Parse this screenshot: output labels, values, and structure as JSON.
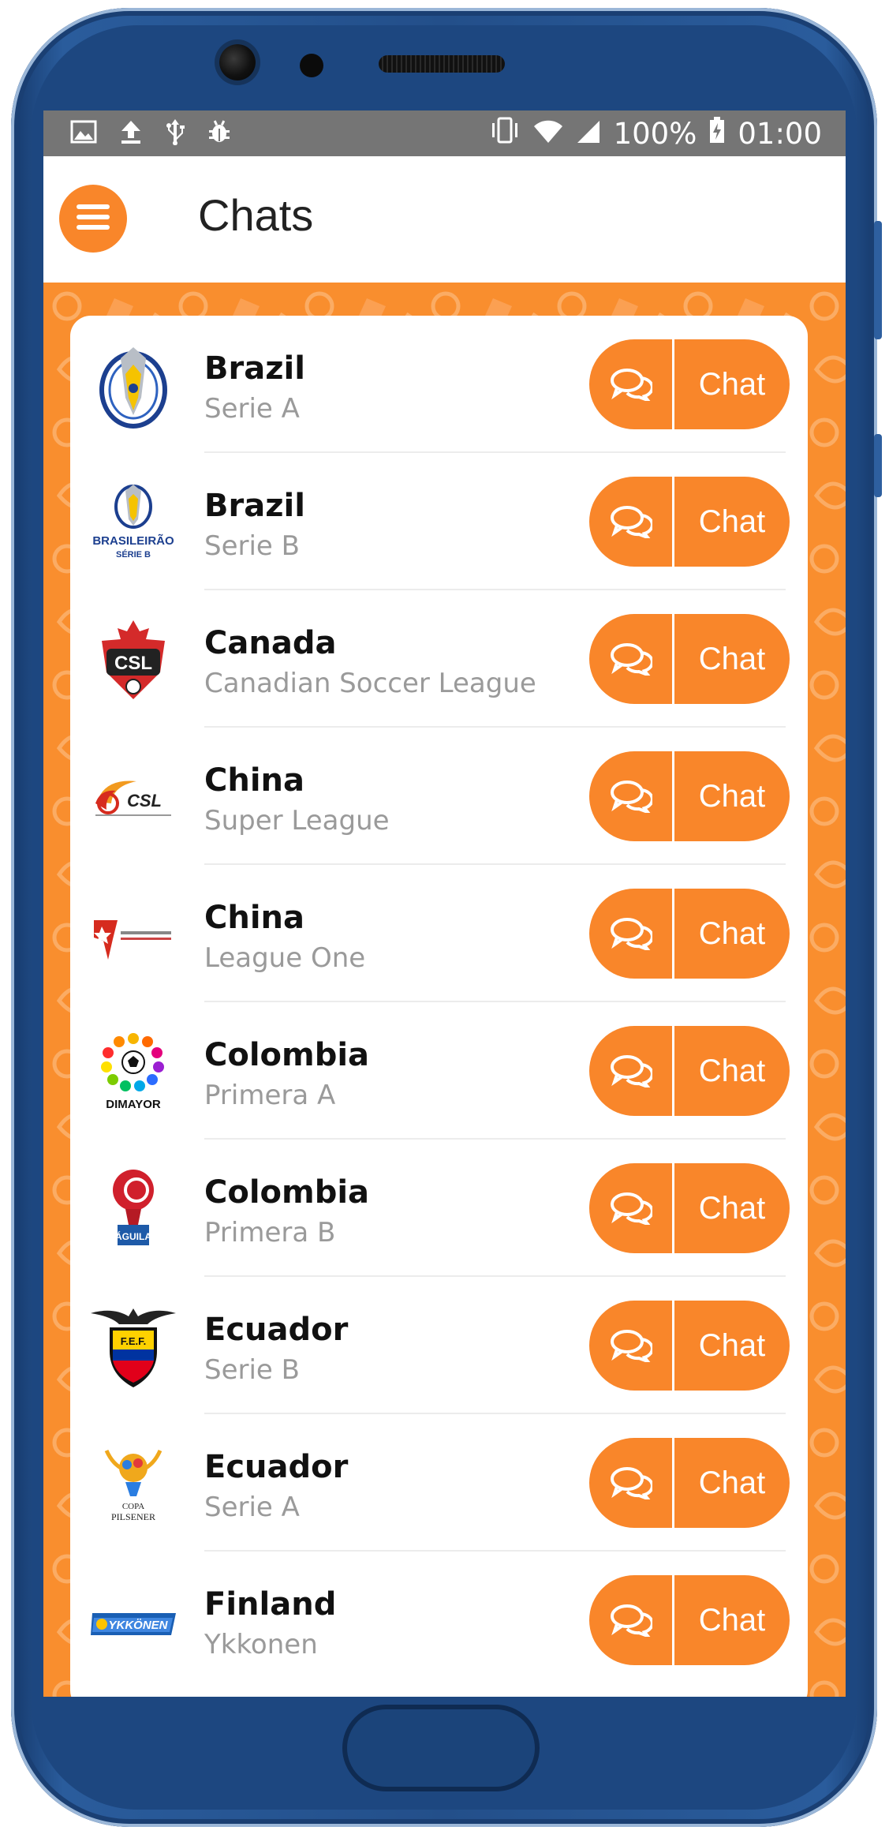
{
  "status_bar": {
    "battery": "100%",
    "time": "01:00",
    "icons": [
      "image-icon",
      "upload-icon",
      "usb-icon",
      "android-debug-icon",
      "vibrate-icon",
      "wifi-icon",
      "signal-icon",
      "battery-icon"
    ]
  },
  "header": {
    "title": "Chats",
    "menu_icon": "hamburger-icon"
  },
  "colors": {
    "accent": "#f9862a",
    "background_pattern": "#f98e2e",
    "country_text": "#111111",
    "league_text": "#9a9a9a"
  },
  "leagues": [
    {
      "country": "Brazil",
      "league": "Serie A",
      "button": "Chat",
      "logo": "brasileirao-serie-a-logo"
    },
    {
      "country": "Brazil",
      "league": "Serie B",
      "button": "Chat",
      "logo": "brasileirao-serie-b-logo",
      "logo_text": "BRASILEIRÃO",
      "logo_subtext": "SÉRIE B"
    },
    {
      "country": "Canada",
      "league": "Canadian Soccer League",
      "button": "Chat",
      "logo": "csl-canada-logo",
      "logo_text": "CSL"
    },
    {
      "country": "China",
      "league": "Super League",
      "button": "Chat",
      "logo": "chinese-super-league-logo",
      "logo_text": "CSL"
    },
    {
      "country": "China",
      "league": "League One",
      "button": "Chat",
      "logo": "china-league-one-logo"
    },
    {
      "country": "Colombia",
      "league": "Primera A",
      "button": "Chat",
      "logo": "dimayor-logo",
      "logo_text": "DIMAYOR"
    },
    {
      "country": "Colombia",
      "league": "Primera B",
      "button": "Chat",
      "logo": "torneo-aguila-logo",
      "logo_text": "ÁGUILA"
    },
    {
      "country": "Ecuador",
      "league": "Serie B",
      "button": "Chat",
      "logo": "fef-ecuador-logo",
      "logo_text": "F.E.F."
    },
    {
      "country": "Ecuador",
      "league": "Serie A",
      "button": "Chat",
      "logo": "copa-pilsener-logo",
      "logo_text": "COPA PILSENER"
    },
    {
      "country": "Finland",
      "league": "Ykkonen",
      "button": "Chat",
      "logo": "ykkonen-logo",
      "logo_text": "YKKÖNEN"
    }
  ]
}
